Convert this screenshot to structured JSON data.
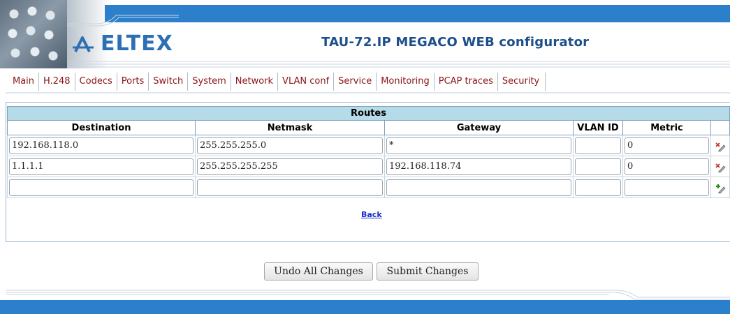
{
  "header": {
    "logo_text": "ELTEX",
    "title": "TAU-72.IP MEGACO WEB configurator",
    "accent": "#2b7fcb"
  },
  "nav": {
    "items": [
      "Main",
      "H.248",
      "Codecs",
      "Ports",
      "Switch",
      "System",
      "Network",
      "VLAN conf",
      "Service",
      "Monitoring",
      "PCAP traces",
      "Security"
    ]
  },
  "routes": {
    "caption": "Routes",
    "columns": [
      "Destination",
      "Netmask",
      "Gateway",
      "VLAN ID",
      "Metric"
    ],
    "rows": [
      {
        "destination": "192.168.118.0",
        "netmask": "255.255.255.0",
        "gateway": "*",
        "vlan_id": "",
        "metric": "0",
        "action_icon": "delete-icon"
      },
      {
        "destination": "1.1.1.1",
        "netmask": "255.255.255.255",
        "gateway": "192.168.118.74",
        "vlan_id": "",
        "metric": "0",
        "action_icon": "delete-icon"
      },
      {
        "destination": "",
        "netmask": "",
        "gateway": "",
        "vlan_id": "",
        "metric": "",
        "action_icon": "add-icon"
      }
    ],
    "back_label": "Back"
  },
  "actions": {
    "undo_label": "Undo All Changes",
    "submit_label": "Submit Changes"
  }
}
